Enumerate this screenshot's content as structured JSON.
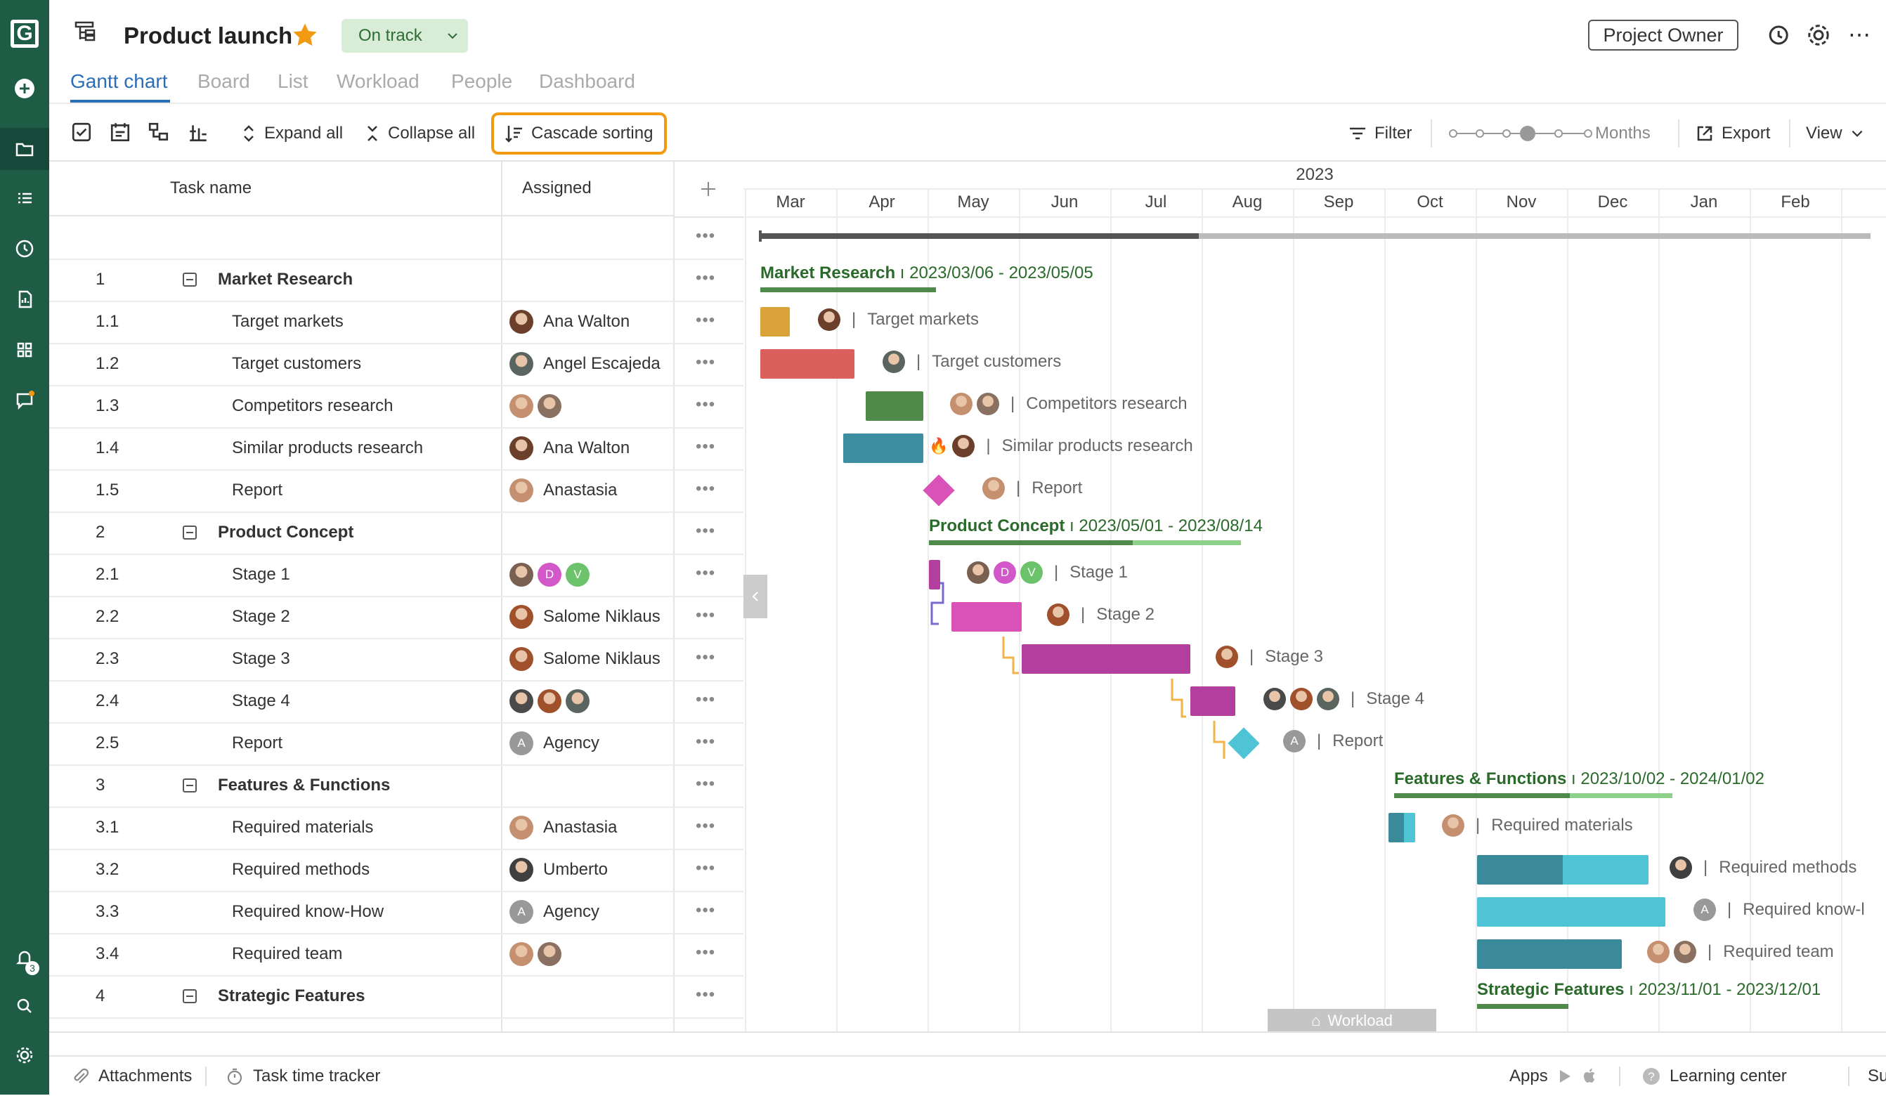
{
  "app": {
    "logo_letter": "G",
    "project_title": "Product launch",
    "status": "On track",
    "owner_button": "Project Owner",
    "notification_count": "3"
  },
  "tabs": [
    "Gantt chart",
    "Board",
    "List",
    "Workload",
    "People",
    "Dashboard"
  ],
  "toolbar": {
    "expand_all": "Expand all",
    "collapse_all": "Collapse all",
    "cascade_sorting": "Cascade sorting",
    "filter": "Filter",
    "zoom_label": "Months",
    "export": "Export",
    "view": "View"
  },
  "grid": {
    "col_task": "Task name",
    "col_assigned": "Assigned",
    "rows": [
      {
        "num": "1",
        "name": "Market Research",
        "group": true,
        "assigned": []
      },
      {
        "num": "1.1",
        "name": "Target markets",
        "assigned": [
          {
            "type": "photo",
            "color": "#6b3f2a"
          }
        ],
        "assigned_text": "Ana Walton"
      },
      {
        "num": "1.2",
        "name": "Target customers",
        "assigned": [
          {
            "type": "photo",
            "color": "#5a6560"
          }
        ],
        "assigned_text": "Angel Escajeda"
      },
      {
        "num": "1.3",
        "name": "Competitors research",
        "assigned": [
          {
            "type": "photo",
            "color": "#c49070"
          },
          {
            "type": "photo",
            "color": "#8a7060"
          }
        ],
        "assigned_text": ""
      },
      {
        "num": "1.4",
        "name": "Similar products research",
        "assigned": [
          {
            "type": "photo",
            "color": "#6b3f2a"
          }
        ],
        "assigned_text": "Ana Walton"
      },
      {
        "num": "1.5",
        "name": "Report",
        "assigned": [
          {
            "type": "photo",
            "color": "#c49070"
          }
        ],
        "assigned_text": "Anastasia"
      },
      {
        "num": "2",
        "name": "Product Concept",
        "group": true,
        "assigned": []
      },
      {
        "num": "2.1",
        "name": "Stage 1",
        "assigned": [
          {
            "type": "photo",
            "color": "#7a6050"
          },
          {
            "type": "letter",
            "letter": "D",
            "color": "#d257c8"
          },
          {
            "type": "letter",
            "letter": "V",
            "color": "#6cc36c"
          }
        ],
        "assigned_text": ""
      },
      {
        "num": "2.2",
        "name": "Stage 2",
        "assigned": [
          {
            "type": "photo",
            "color": "#a0502a"
          }
        ],
        "assigned_text": "Salome Niklaus"
      },
      {
        "num": "2.3",
        "name": "Stage 3",
        "assigned": [
          {
            "type": "photo",
            "color": "#a0502a"
          }
        ],
        "assigned_text": "Salome Niklaus"
      },
      {
        "num": "2.4",
        "name": "Stage 4",
        "assigned": [
          {
            "type": "photo",
            "color": "#4a4a4a"
          },
          {
            "type": "photo",
            "color": "#a0502a"
          },
          {
            "type": "photo",
            "color": "#5a6560"
          }
        ],
        "assigned_text": ""
      },
      {
        "num": "2.5",
        "name": "Report",
        "assigned": [
          {
            "type": "letter",
            "letter": "A",
            "color": "#999999"
          }
        ],
        "assigned_text": "Agency"
      },
      {
        "num": "3",
        "name": "Features & Functions",
        "group": true,
        "assigned": []
      },
      {
        "num": "3.1",
        "name": "Required materials",
        "assigned": [
          {
            "type": "photo",
            "color": "#c49070"
          }
        ],
        "assigned_text": "Anastasia"
      },
      {
        "num": "3.2",
        "name": "Required methods",
        "assigned": [
          {
            "type": "photo",
            "color": "#3f3f3f"
          }
        ],
        "assigned_text": "Umberto"
      },
      {
        "num": "3.3",
        "name": "Required know-How",
        "assigned": [
          {
            "type": "letter",
            "letter": "A",
            "color": "#999999"
          }
        ],
        "assigned_text": "Agency"
      },
      {
        "num": "3.4",
        "name": "Required team",
        "assigned": [
          {
            "type": "photo",
            "color": "#c49070"
          },
          {
            "type": "photo",
            "color": "#8a7060"
          }
        ],
        "assigned_text": ""
      },
      {
        "num": "4",
        "name": "Strategic Features",
        "group": true,
        "assigned": []
      }
    ]
  },
  "timeline": {
    "year": "2023",
    "months": [
      "Mar",
      "Apr",
      "May",
      "Jun",
      "Jul",
      "Aug",
      "Sep",
      "Oct",
      "Nov",
      "Dec",
      "Jan",
      "Feb"
    ],
    "groups": [
      {
        "name": "Market Research",
        "dates": "2023/03/06 - 2023/05/05"
      },
      {
        "name": "Product Concept",
        "dates": "2023/05/01 - 2023/08/14"
      },
      {
        "name": "Features & Functions",
        "dates": "2023/10/02 - 2024/01/02"
      },
      {
        "name": "Strategic Features",
        "dates": "2023/11/01 - 2023/12/01"
      }
    ],
    "task_labels": [
      "Target markets",
      "Target customers",
      "Competitors research",
      "Similar products research",
      "Report",
      "Stage 1",
      "Stage 2",
      "Stage 3",
      "Stage 4",
      "Report",
      "Required materials",
      "Required methods",
      "Required know-l",
      "Required team"
    ],
    "workload_tab": "Workload",
    "colors": {
      "orange": "#d9a33a",
      "red": "#d9605c",
      "green": "#4f8a4a",
      "teal": "#3d8ea0",
      "pink": "#d852b8",
      "magenta": "#b23e9e",
      "cyan": "#4fc4d4",
      "darkteal": "#3a8a9a",
      "group_line": "#4f8a4a",
      "group_line_light": "#8fd08a"
    }
  },
  "footer": {
    "attachments": "Attachments",
    "time_tracker": "Task time tracker",
    "apps": "Apps",
    "learning_center": "Learning center",
    "support": "Support"
  }
}
